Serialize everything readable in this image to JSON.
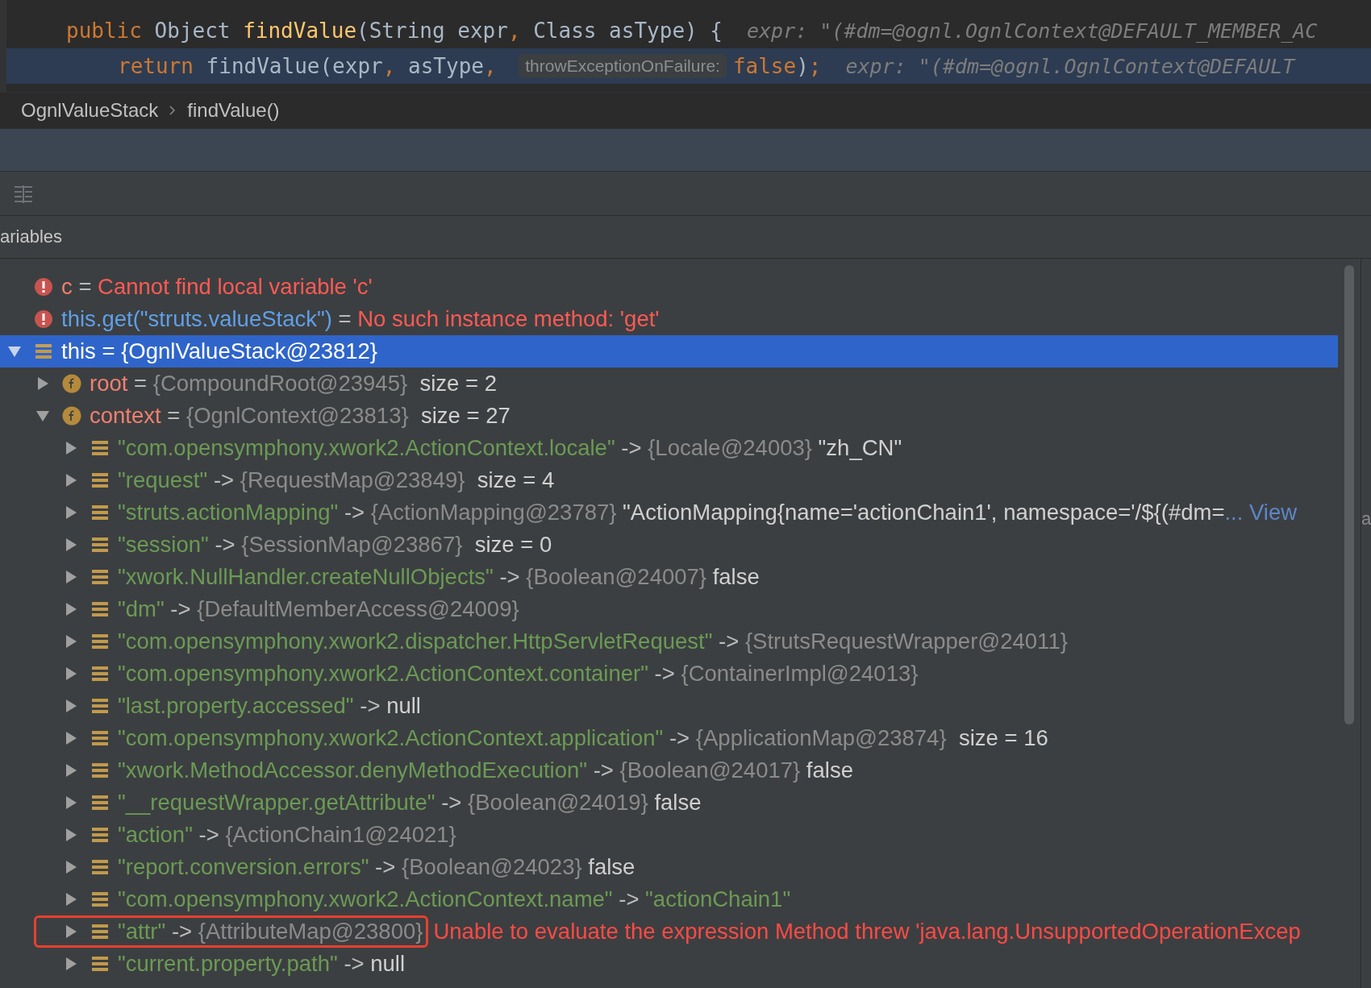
{
  "editor": {
    "lines": [
      {
        "highlighted": false,
        "tokens": [
          {
            "kind": "keyword",
            "text": "public "
          },
          {
            "kind": "plain",
            "text": "Object "
          },
          {
            "kind": "method",
            "text": "findValue"
          },
          {
            "kind": "plain",
            "text": "(String expr"
          },
          {
            "kind": "keyword",
            "text": ", "
          },
          {
            "kind": "plain",
            "text": "Class asType) {"
          },
          {
            "kind": "inline",
            "text": "expr: \"(#dm=@ognl.OgnlContext@DEFAULT_MEMBER_AC"
          }
        ]
      },
      {
        "highlighted": true,
        "tokens": [
          {
            "kind": "keyword",
            "text": "return "
          },
          {
            "kind": "plain",
            "text": "findValue(expr"
          },
          {
            "kind": "keyword",
            "text": ", "
          },
          {
            "kind": "plain",
            "text": "asType"
          },
          {
            "kind": "keyword",
            "text": ", "
          },
          {
            "kind": "hint",
            "text": "throwExceptionOnFailure:"
          },
          {
            "kind": "keyword",
            "text": "false"
          },
          {
            "kind": "plain",
            "text": ")"
          },
          {
            "kind": "keyword",
            "text": ";"
          },
          {
            "kind": "inline",
            "text": "expr: \"(#dm=@ognl.OgnlContext@DEFAULT"
          }
        ]
      }
    ]
  },
  "breadcrumbs": [
    "OgnlValueStack",
    "findValue()"
  ],
  "panel": {
    "title": "ariables",
    "side_text": "a"
  },
  "tree": [
    {
      "kind": "error",
      "selected": false,
      "tokens": [
        {
          "kind": "field",
          "text": "c"
        },
        {
          "kind": "op",
          "text": " = "
        },
        {
          "kind": "error",
          "text": "Cannot find local variable 'c'"
        }
      ]
    },
    {
      "kind": "error",
      "selected": false,
      "tokens": [
        {
          "kind": "expr",
          "text": "this.get(\"struts.valueStack\")"
        },
        {
          "kind": "op",
          "text": " = "
        },
        {
          "kind": "error",
          "text": "No such instance method: 'get'"
        }
      ]
    },
    {
      "kind": "object",
      "selected": true,
      "expanded": true,
      "tokens": [
        {
          "kind": "value",
          "text": "this = {OgnlValueStack@23812}"
        }
      ],
      "children": [
        {
          "kind": "field",
          "selected": false,
          "expanded": false,
          "tokens": [
            {
              "kind": "field",
              "text": "root"
            },
            {
              "kind": "op",
              "text": " = "
            },
            {
              "kind": "ref",
              "text": "{CompoundRoot@23945}"
            },
            {
              "kind": "value",
              "text": "  size = 2"
            }
          ]
        },
        {
          "kind": "field",
          "selected": false,
          "expanded": true,
          "tokens": [
            {
              "kind": "field",
              "text": "context"
            },
            {
              "kind": "op",
              "text": " = "
            },
            {
              "kind": "ref",
              "text": "{OgnlContext@23813}"
            },
            {
              "kind": "value",
              "text": "  size = 27"
            }
          ],
          "children": [
            {
              "kind": "entry",
              "selected": false,
              "expanded": false,
              "tokens": [
                {
                  "kind": "key",
                  "text": "\"com.opensymphony.xwork2.ActionContext.locale\""
                },
                {
                  "kind": "op",
                  "text": " -> "
                },
                {
                  "kind": "ref",
                  "text": "{Locale@24003}"
                },
                {
                  "kind": "value",
                  "text": " \"zh_CN\""
                }
              ]
            },
            {
              "kind": "entry",
              "selected": false,
              "expanded": false,
              "tokens": [
                {
                  "kind": "key",
                  "text": "\"request\""
                },
                {
                  "kind": "op",
                  "text": " -> "
                },
                {
                  "kind": "ref",
                  "text": "{RequestMap@23849}"
                },
                {
                  "kind": "value",
                  "text": "  size = 4"
                }
              ]
            },
            {
              "kind": "entry",
              "selected": false,
              "expanded": false,
              "tokens": [
                {
                  "kind": "key",
                  "text": "\"struts.actionMapping\""
                },
                {
                  "kind": "op",
                  "text": " -> "
                },
                {
                  "kind": "ref",
                  "text": "{ActionMapping@23787}"
                },
                {
                  "kind": "value",
                  "text": " \"ActionMapping{name='actionChain1', namespace='/${(#dm="
                },
                {
                  "kind": "link",
                  "text": "... View"
                }
              ]
            },
            {
              "kind": "entry",
              "selected": false,
              "expanded": false,
              "tokens": [
                {
                  "kind": "key",
                  "text": "\"session\""
                },
                {
                  "kind": "op",
                  "text": " -> "
                },
                {
                  "kind": "ref",
                  "text": "{SessionMap@23867}"
                },
                {
                  "kind": "value",
                  "text": "  size = 0"
                }
              ]
            },
            {
              "kind": "entry",
              "selected": false,
              "expanded": false,
              "tokens": [
                {
                  "kind": "key",
                  "text": "\"xwork.NullHandler.createNullObjects\""
                },
                {
                  "kind": "op",
                  "text": " -> "
                },
                {
                  "kind": "ref",
                  "text": "{Boolean@24007}"
                },
                {
                  "kind": "value",
                  "text": " false"
                }
              ]
            },
            {
              "kind": "entry",
              "selected": false,
              "expanded": false,
              "tokens": [
                {
                  "kind": "key",
                  "text": "\"dm\""
                },
                {
                  "kind": "op",
                  "text": " -> "
                },
                {
                  "kind": "ref",
                  "text": "{DefaultMemberAccess@24009}"
                }
              ]
            },
            {
              "kind": "entry",
              "selected": false,
              "expanded": false,
              "tokens": [
                {
                  "kind": "key",
                  "text": "\"com.opensymphony.xwork2.dispatcher.HttpServletRequest\""
                },
                {
                  "kind": "op",
                  "text": " -> "
                },
                {
                  "kind": "ref",
                  "text": "{StrutsRequestWrapper@24011}"
                }
              ]
            },
            {
              "kind": "entry",
              "selected": false,
              "expanded": false,
              "tokens": [
                {
                  "kind": "key",
                  "text": "\"com.opensymphony.xwork2.ActionContext.container\""
                },
                {
                  "kind": "op",
                  "text": " -> "
                },
                {
                  "kind": "ref",
                  "text": "{ContainerImpl@24013}"
                }
              ]
            },
            {
              "kind": "entry",
              "selected": false,
              "expanded": false,
              "tokens": [
                {
                  "kind": "key",
                  "text": "\"last.property.accessed\""
                },
                {
                  "kind": "op",
                  "text": " -> "
                },
                {
                  "kind": "value",
                  "text": "null"
                }
              ]
            },
            {
              "kind": "entry",
              "selected": false,
              "expanded": false,
              "tokens": [
                {
                  "kind": "key",
                  "text": "\"com.opensymphony.xwork2.ActionContext.application\""
                },
                {
                  "kind": "op",
                  "text": " -> "
                },
                {
                  "kind": "ref",
                  "text": "{ApplicationMap@23874}"
                },
                {
                  "kind": "value",
                  "text": "  size = 16"
                }
              ]
            },
            {
              "kind": "entry",
              "selected": false,
              "expanded": false,
              "tokens": [
                {
                  "kind": "key",
                  "text": "\"xwork.MethodAccessor.denyMethodExecution\""
                },
                {
                  "kind": "op",
                  "text": " -> "
                },
                {
                  "kind": "ref",
                  "text": "{Boolean@24017}"
                },
                {
                  "kind": "value",
                  "text": " false"
                }
              ]
            },
            {
              "kind": "entry",
              "selected": false,
              "expanded": false,
              "tokens": [
                {
                  "kind": "key",
                  "text": "\"__requestWrapper.getAttribute\""
                },
                {
                  "kind": "op",
                  "text": " -> "
                },
                {
                  "kind": "ref",
                  "text": "{Boolean@24019}"
                },
                {
                  "kind": "value",
                  "text": " false"
                }
              ]
            },
            {
              "kind": "entry",
              "selected": false,
              "expanded": false,
              "tokens": [
                {
                  "kind": "key",
                  "text": "\"action\""
                },
                {
                  "kind": "op",
                  "text": " -> "
                },
                {
                  "kind": "ref",
                  "text": "{ActionChain1@24021}"
                }
              ]
            },
            {
              "kind": "entry",
              "selected": false,
              "expanded": false,
              "tokens": [
                {
                  "kind": "key",
                  "text": "\"report.conversion.errors\""
                },
                {
                  "kind": "op",
                  "text": " -> "
                },
                {
                  "kind": "ref",
                  "text": "{Boolean@24023}"
                },
                {
                  "kind": "value",
                  "text": " false"
                }
              ]
            },
            {
              "kind": "entry",
              "selected": false,
              "expanded": false,
              "tokens": [
                {
                  "kind": "key",
                  "text": "\"com.opensymphony.xwork2.ActionContext.name\""
                },
                {
                  "kind": "op",
                  "text": " -> "
                },
                {
                  "kind": "key",
                  "text": "\"actionChain1\""
                }
              ]
            },
            {
              "kind": "entry",
              "selected": false,
              "expanded": false,
              "boxed": true,
              "tokens": [
                {
                  "kind": "key",
                  "text": "\"attr\""
                },
                {
                  "kind": "op",
                  "text": " -> "
                },
                {
                  "kind": "ref",
                  "text": "{AttributeMap@23800}"
                }
              ],
              "message": "Unable to evaluate the expression Method threw 'java.lang.UnsupportedOperationExcep"
            },
            {
              "kind": "entry",
              "selected": false,
              "expanded": false,
              "tokens": [
                {
                  "kind": "key",
                  "text": "\"current.property.path\""
                },
                {
                  "kind": "op",
                  "text": " -> "
                },
                {
                  "kind": "value",
                  "text": "null"
                }
              ]
            }
          ]
        }
      ]
    }
  ]
}
